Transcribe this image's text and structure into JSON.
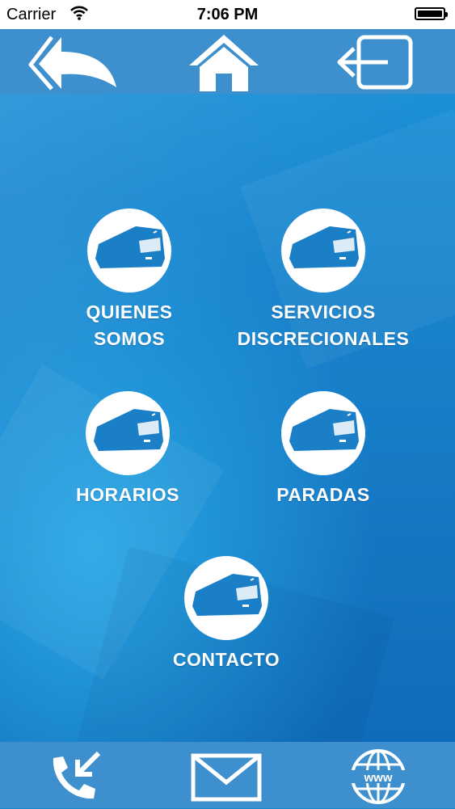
{
  "status_bar": {
    "carrier": "Carrier",
    "time": "7:06 PM",
    "wifi_icon": "wifi-icon",
    "battery_icon": "battery-icon"
  },
  "top_bar": {
    "back_icon": "back-arrow-icon",
    "home_icon": "home-icon",
    "exit_icon": "exit-icon"
  },
  "menu": {
    "items": [
      {
        "label_line1": "QUIENES",
        "label_line2": "SOMOS",
        "icon": "bus-icon"
      },
      {
        "label_line1": "SERVICIOS",
        "label_line2": "DISCRECIONALES",
        "icon": "bus-icon"
      },
      {
        "label_line1": "HORARIOS",
        "label_line2": "",
        "icon": "bus-icon"
      },
      {
        "label_line1": "PARADAS",
        "label_line2": "",
        "icon": "bus-icon"
      },
      {
        "label_line1": "CONTACTO",
        "label_line2": "",
        "icon": "bus-icon"
      }
    ]
  },
  "bottom_bar": {
    "phone_icon": "phone-call-icon",
    "mail_icon": "mail-icon",
    "web_icon": "globe-www-icon",
    "web_text": "www"
  },
  "colors": {
    "bar": "#3d8fcd",
    "background": "#1a8ad0",
    "bus_fill": "#1a7fc6",
    "text": "#ffffff"
  }
}
